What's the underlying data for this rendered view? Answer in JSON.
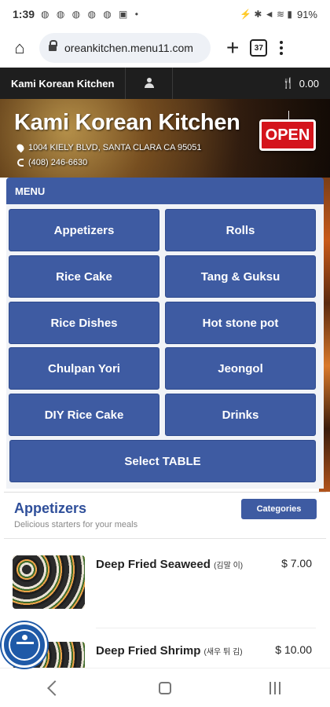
{
  "status": {
    "time": "1:39",
    "left_icons": "с ф ф г ф □ •",
    "right_icons": "⚡ ✱ ⚠ ☲ ▎",
    "battery": "91%"
  },
  "browser": {
    "url": "oreankitchen.menu11.com",
    "tabs_count": "37"
  },
  "nav": {
    "brand": "Kami Korean Kitchen",
    "cart_total": "0.00"
  },
  "hero": {
    "title": "Kami Korean Kitchen",
    "address": "1004 KIELY BLVD, SANTA CLARA CA 95051",
    "phone": "(408) 246-6630",
    "open_label": "OPEN"
  },
  "menu": {
    "header": "MENU",
    "buttons": [
      "Appetizers",
      "Rolls",
      "Rice Cake",
      "Tang & Guksu",
      "Rice Dishes",
      "Hot stone pot",
      "Chulpan Yori",
      "Jeongol",
      "DIY Rice Cake",
      "Drinks"
    ],
    "select_table": "Select TABLE"
  },
  "section": {
    "title": "Appetizers",
    "subtitle": "Delicious starters for your meals",
    "categories_label": "Categories",
    "items": [
      {
        "name": "Deep Fried Seaweed",
        "korean": "(김말 이)",
        "price": "$ 7.00"
      },
      {
        "name": "Deep Fried Shrimp",
        "korean": "(새우 튀 김)",
        "price": "$ 10.00"
      }
    ]
  },
  "colors": {
    "accent": "#3e5ba2",
    "nav_bg": "#1e1e1e",
    "open_red": "#d4141c"
  }
}
